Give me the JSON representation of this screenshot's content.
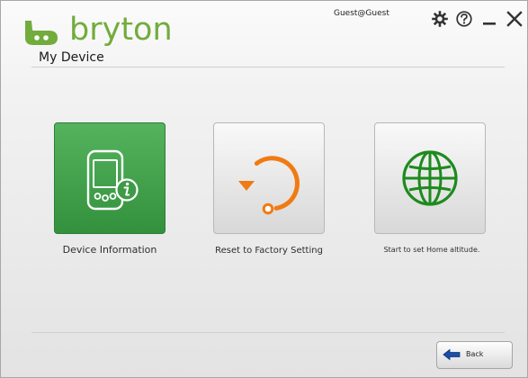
{
  "app": {
    "brand": "bryton",
    "user": "Guest@Guest"
  },
  "page": {
    "title": "My Device"
  },
  "tiles": {
    "device_info_label": "Device Information",
    "reset_label": "Reset to Factory Setting",
    "home_altitude_label": "Start to set Home altitude."
  },
  "footer": {
    "back_label": "Back"
  },
  "icons": {
    "logo": "bryton-bike-icon",
    "settings": "gear-icon",
    "help": "help-icon",
    "minimize": "minimize-icon",
    "close": "close-icon",
    "device_info": "device-info-icon",
    "reset": "reset-icon",
    "home_altitude": "globe-icon",
    "back": "back-arrow-icon"
  },
  "colors": {
    "brand_green": "#72AC3C",
    "tile_green": "#45A24E",
    "reset_orange": "#F07B12",
    "globe_green": "#1E8A1E",
    "back_blue": "#1A4FA8"
  }
}
